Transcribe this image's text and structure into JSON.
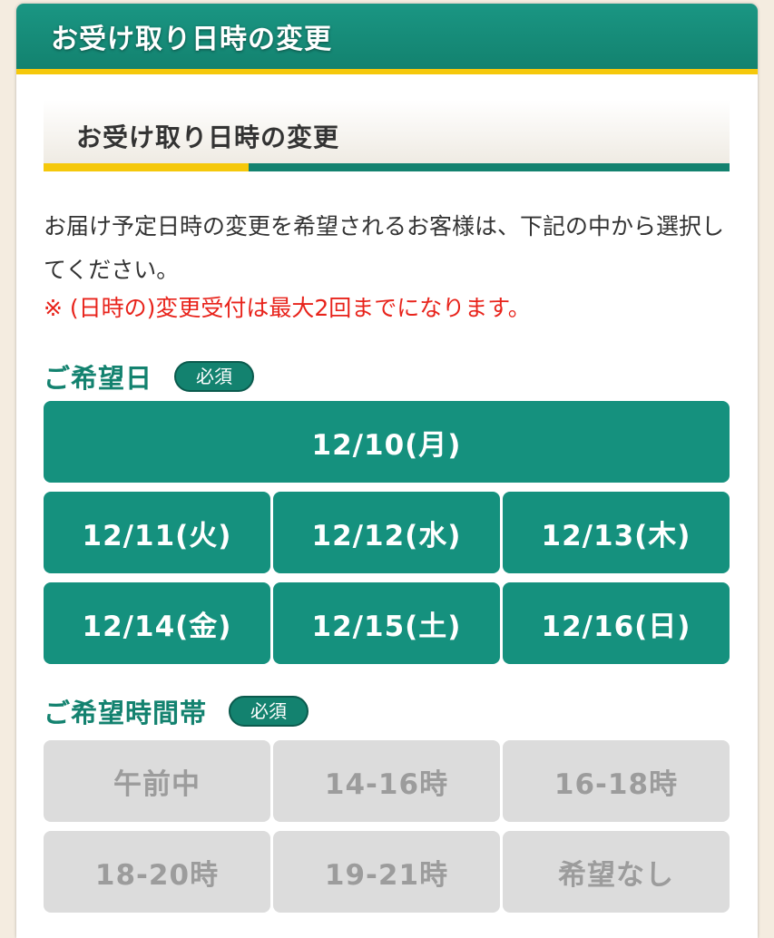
{
  "header": {
    "title": "お受け取り日時の変更"
  },
  "section": {
    "heading": "お受け取り日時の変更"
  },
  "description": "お届け予定日時の変更を希望されるお客様は、下記の中から選択してください。",
  "notice": "※ (日時の)変更受付は最大2回までになります。",
  "date_field": {
    "label": "ご希望日",
    "required": "必須",
    "options": [
      "12/10(月)",
      "12/11(火)",
      "12/12(水)",
      "12/13(木)",
      "12/14(金)",
      "12/15(土)",
      "12/16(日)"
    ]
  },
  "time_field": {
    "label": "ご希望時間帯",
    "required": "必須",
    "options": [
      "午前中",
      "14-16時",
      "16-18時",
      "18-20時",
      "19-21時",
      "希望なし"
    ]
  },
  "colors": {
    "brand_green": "#15917e",
    "accent_yellow": "#f5c80b",
    "notice_red": "#e8231b",
    "disabled_gray": "#dcdcdc"
  }
}
